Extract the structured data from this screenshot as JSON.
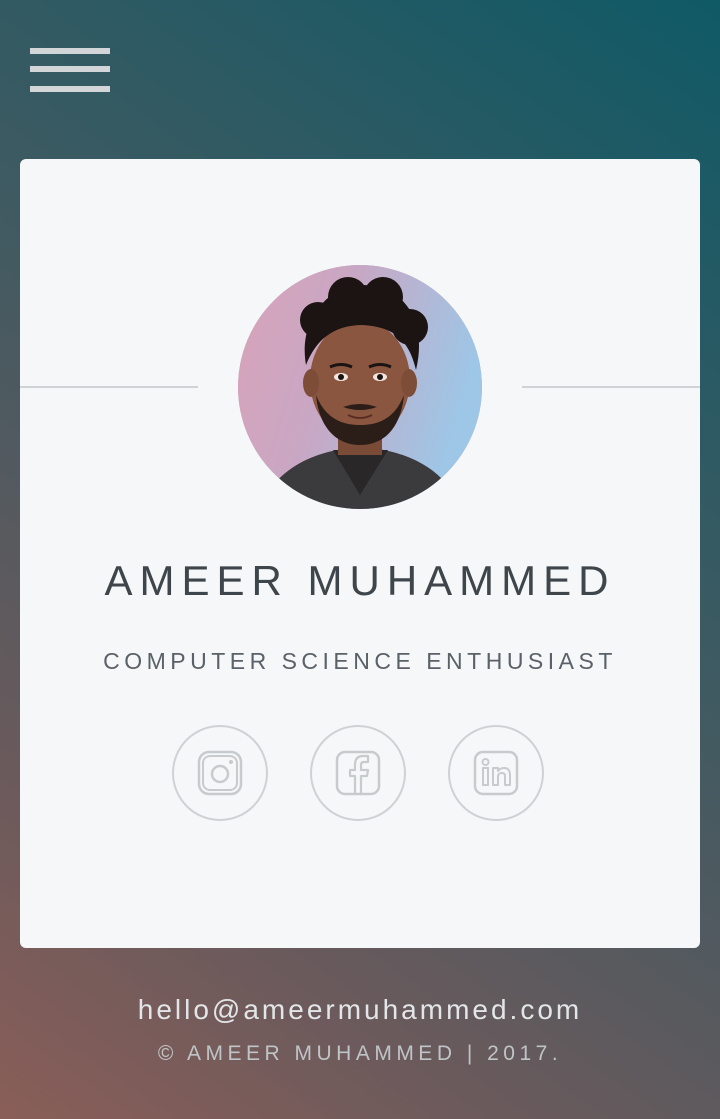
{
  "menu": {
    "icon": "hamburger-menu-icon"
  },
  "profile": {
    "name": "AMEER MUHAMMED",
    "tagline": "COMPUTER SCIENCE ENTHUSIAST",
    "avatar": "profile-photo"
  },
  "social": [
    {
      "icon": "instagram-icon"
    },
    {
      "icon": "facebook-icon"
    },
    {
      "icon": "linkedin-icon"
    }
  ],
  "footer": {
    "email": "hello@ameermuhammed.com",
    "copyright": "© AMEER MUHAMMED | 2017."
  },
  "colors": {
    "background_top": "#0f5a66",
    "background_bottom": "#8a5e58",
    "card": "#f5f7f8",
    "text": "#3e454b",
    "icon_stroke": "#c8cbce"
  }
}
